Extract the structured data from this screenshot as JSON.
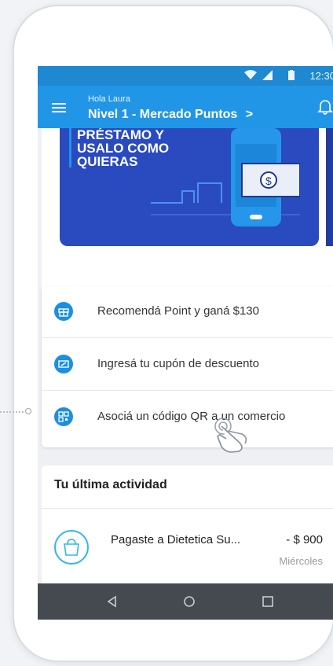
{
  "status_bar": {
    "time": "12:30"
  },
  "app_bar": {
    "greeting": "Hola Laura",
    "level": "Nivel 1 - Mercado Puntos",
    "chevron": ">"
  },
  "banner": {
    "promo_text": "PRÉSTAMO Y\nUSALO COMO\nQUIERAS",
    "color": "#2a4bbf"
  },
  "actions": [
    {
      "label": "Recomendá Point y ganá $130",
      "icon": "gift-icon"
    },
    {
      "label": "Ingresá tu cupón de descuento",
      "icon": "coupon-icon"
    },
    {
      "label": "Asociá un código QR a un comercio",
      "icon": "qr-icon"
    }
  ],
  "activity": {
    "title": "Tu última actividad",
    "items": [
      {
        "description": "Pagaste a Dietetica Su...",
        "amount": "- $ 900",
        "date": "Miércoles",
        "icon": "shopping-bag-icon"
      }
    ]
  },
  "colors": {
    "accent": "#2296e6",
    "statusbar": "#1e88d1",
    "navbar": "#454a50"
  }
}
